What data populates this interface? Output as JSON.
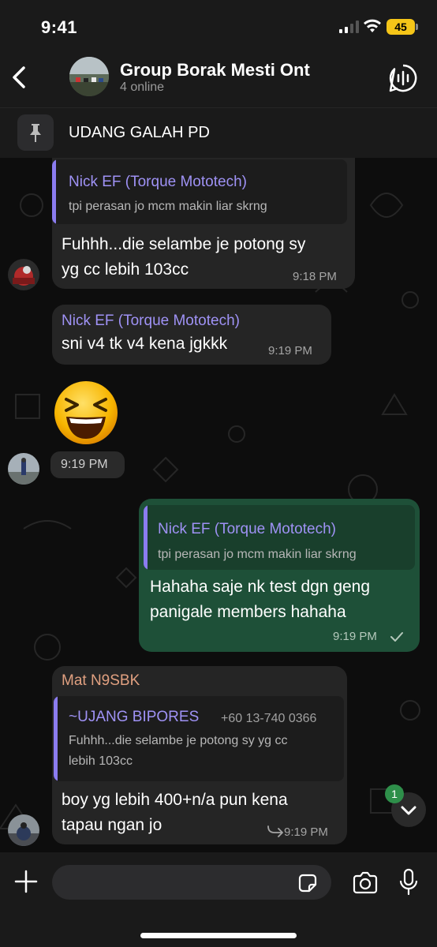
{
  "status_bar": {
    "time": "9:41",
    "battery": "45"
  },
  "header": {
    "title": "Group Borak Mesti Ont",
    "subtitle": "4 online"
  },
  "pinned": {
    "text": "UDANG GALAH PD"
  },
  "messages": [
    {
      "reply_name": "Nick EF (Torque Mototech)",
      "reply_text": "tpi perasan jo mcm makin liar skrng",
      "lines": [
        "Fuhhh...die selambe je potong sy",
        "yg cc lebih 103cc"
      ],
      "time": "9:18 PM"
    },
    {
      "sender": "Nick EF (Torque Mototech)",
      "lines": [
        "sni v4 tk v4 kena jgkkk"
      ],
      "time": "9:19 PM"
    },
    {
      "emoji": "😆",
      "time": "9:19 PM"
    },
    {
      "reply_name": "Nick EF (Torque Mototech)",
      "reply_text": "tpi perasan jo mcm makin liar skrng",
      "lines": [
        "Hahaha saje nk test dgn geng",
        "panigale members hahaha"
      ],
      "time": "9:19 PM"
    },
    {
      "sender": "Mat N9SBK",
      "reply_name": "~UJANG BIPORES",
      "reply_phone": "+60 13-740 0366",
      "reply_lines": [
        "Fuhhh...die selambe je potong sy yg cc",
        "lebih 103cc"
      ],
      "lines": [
        "boy yg lebih 400+n/a pun kena",
        "tapau ngan jo"
      ],
      "time": "9:19 PM"
    }
  ],
  "scroll": {
    "badge": "1"
  },
  "input": {
    "placeholder": ""
  },
  "colors": {
    "outgoing": "#1e5038",
    "incoming": "#252525",
    "reply_name": "#9f92f5",
    "sender_orange": "#e0a080",
    "badge": "#2e8f4a",
    "battery": "#f5c518"
  }
}
